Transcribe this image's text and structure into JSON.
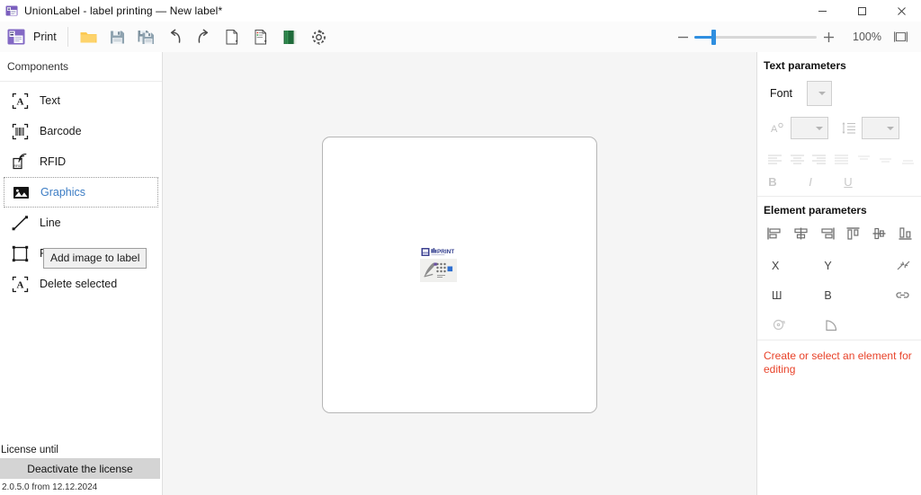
{
  "window": {
    "title": "UnionLabel - label printing — New label*",
    "app_icon": "printer-icon",
    "minimize_label": "Minimize",
    "maximize_label": "Maximize",
    "close_label": "Close"
  },
  "toolbar": {
    "print_label": "Print",
    "print_icon": "printer-icon",
    "buttons": [
      {
        "name": "open-file-button",
        "icon": "folder-open-icon",
        "tooltip": "Open"
      },
      {
        "name": "save-button",
        "icon": "floppy-save-icon",
        "tooltip": "Save"
      },
      {
        "name": "save-as-button",
        "icon": "floppy-save-as-icon",
        "tooltip": "Save as"
      },
      {
        "name": "undo-button",
        "icon": "undo-arrow-icon",
        "tooltip": "Undo"
      },
      {
        "name": "redo-button",
        "icon": "redo-arrow-icon",
        "tooltip": "Redo"
      },
      {
        "name": "new-label-button",
        "icon": "document-new-icon",
        "tooltip": "New label"
      },
      {
        "name": "label-data-button",
        "icon": "document-data-icon",
        "tooltip": "Label data"
      },
      {
        "name": "database-button",
        "icon": "green-book-icon",
        "tooltip": "Database"
      },
      {
        "name": "settings-button",
        "icon": "gear-icon",
        "tooltip": "Settings"
      }
    ],
    "zoom": {
      "minus_label": "−",
      "plus_label": "+",
      "percent": "100%",
      "fit_icon": "fit-to-screen-icon",
      "slider_value": 14
    }
  },
  "sidebar": {
    "header": "Components",
    "items": [
      {
        "label": "Text",
        "icon": "text-a-icon",
        "selected": false
      },
      {
        "label": "Barcode",
        "icon": "barcode-icon",
        "selected": false
      },
      {
        "label": "RFID",
        "icon": "rfid-tag-icon",
        "selected": false
      },
      {
        "label": "Graphics",
        "icon": "image-icon",
        "selected": true
      },
      {
        "label": "Line",
        "icon": "line-icon",
        "selected": false
      },
      {
        "label": "Rectangle",
        "icon": "rectangle-icon",
        "selected": false
      },
      {
        "label": "Delete selected",
        "icon": "text-a-icon",
        "selected": false
      }
    ],
    "tooltip": "Add image to label",
    "license_text": "License until",
    "license_button": "Deactivate the license",
    "version": "2.0.5.0 from 12.12.2024"
  },
  "canvas": {
    "label_image_alt": "PRINT logo graphic"
  },
  "right_panel": {
    "text_parameters_title": "Text parameters",
    "font_label": "Font",
    "font_value": "",
    "font_size_icon": "font-size-icon",
    "font_size_value": "",
    "line_spacing_icon": "line-spacing-icon",
    "line_spacing_value": "",
    "text_align_icons": [
      "align-left-icon",
      "align-center-icon",
      "align-right-icon",
      "align-justify-icon",
      "align-top-text-icon",
      "align-middle-text-icon",
      "align-bottom-text-icon"
    ],
    "bold_label": "B",
    "italic_label": "I",
    "underline_label": "U",
    "element_parameters_title": "Element parameters",
    "element_align_icons": [
      "align-objects-left-icon",
      "align-objects-center-icon",
      "align-objects-right-icon",
      "align-objects-top-icon",
      "align-objects-middle-icon",
      "align-objects-bottom-icon"
    ],
    "fields": {
      "x_label": "X",
      "y_label": "Y",
      "resize_icon": "resize-diagonal-icon",
      "width_label": "Ш",
      "height_label": "В",
      "link_icon": "link-chain-icon",
      "rotate_icon": "rotate-icon",
      "corner_icon": "corner-radius-icon"
    },
    "hint_message": "Create or select an element for editing",
    "hint_color": "#e8432a"
  }
}
